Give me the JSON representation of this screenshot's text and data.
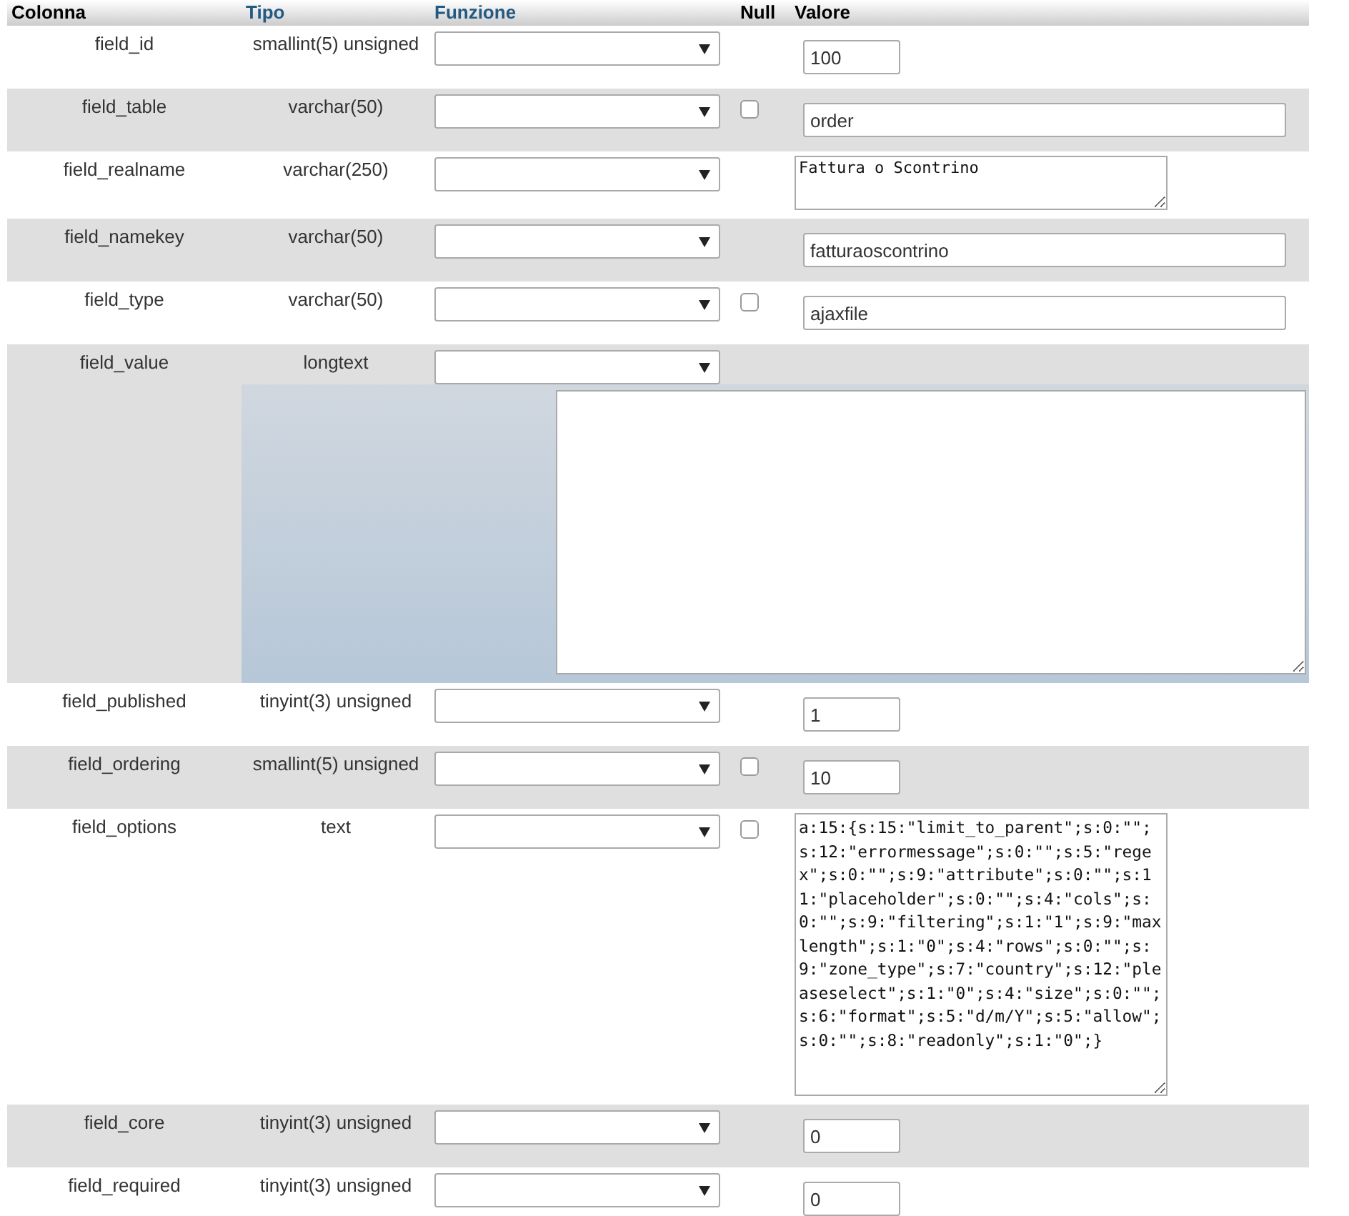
{
  "columns": [
    {
      "label": "Colonna",
      "kind": "plain"
    },
    {
      "label": "Tipo",
      "kind": "link"
    },
    {
      "label": "Funzione",
      "kind": "link"
    },
    {
      "label": "Null",
      "kind": "plain"
    },
    {
      "label": "Valore",
      "kind": "plain"
    }
  ],
  "rows": [
    {
      "column": "field_id",
      "type": "smallint(5) unsigned",
      "value": {
        "kind": "short",
        "text": "100"
      }
    },
    {
      "column": "field_table",
      "type": "varchar(50)",
      "null": {
        "checked": false
      },
      "value": {
        "kind": "wide",
        "text": "order"
      }
    },
    {
      "column": "field_realname",
      "type": "varchar(250)",
      "value": {
        "kind": "textarea",
        "text": "Fattura o Scontrino"
      }
    },
    {
      "column": "field_namekey",
      "type": "varchar(50)",
      "value": {
        "kind": "wide",
        "text": "fatturaoscontrino"
      }
    },
    {
      "column": "field_type",
      "type": "varchar(50)",
      "null": {
        "checked": false
      },
      "value": {
        "kind": "wide",
        "text": "ajaxfile"
      }
    },
    {
      "column": "field_value",
      "type": "longtext",
      "value": {
        "kind": "blob"
      }
    },
    {
      "column": "field_published",
      "type": "tinyint(3) unsigned",
      "value": {
        "kind": "short",
        "text": "1"
      }
    },
    {
      "column": "field_ordering",
      "type": "smallint(5) unsigned",
      "null": {
        "checked": false
      },
      "value": {
        "kind": "short",
        "text": "10"
      }
    },
    {
      "column": "field_options",
      "type": "text",
      "null": {
        "checked": false
      },
      "value": {
        "kind": "bigtextarea",
        "text": "a:15:{s:15:\"limit_to_parent\";s:0:\"\";s:12:\"errormessage\";s:0:\"\";s:5:\"regex\";s:0:\"\";s:9:\"attribute\";s:0:\"\";s:11:\"placeholder\";s:0:\"\";s:4:\"cols\";s:0:\"\";s:9:\"filtering\";s:1:\"1\";s:9:\"maxlength\";s:1:\"0\";s:4:\"rows\";s:0:\"\";s:9:\"zone_type\";s:7:\"country\";s:12:\"pleaseselect\";s:1:\"0\";s:4:\"size\";s:0:\"\";s:6:\"format\";s:5:\"d/m/Y\";s:5:\"allow\";s:0:\"\";s:8:\"readonly\";s:1:\"0\";}"
      }
    },
    {
      "column": "field_core",
      "type": "tinyint(3) unsigned",
      "value": {
        "kind": "short",
        "text": "0"
      }
    },
    {
      "column": "field_required",
      "type": "tinyint(3) unsigned",
      "value": {
        "kind": "short",
        "text": "0"
      }
    }
  ]
}
